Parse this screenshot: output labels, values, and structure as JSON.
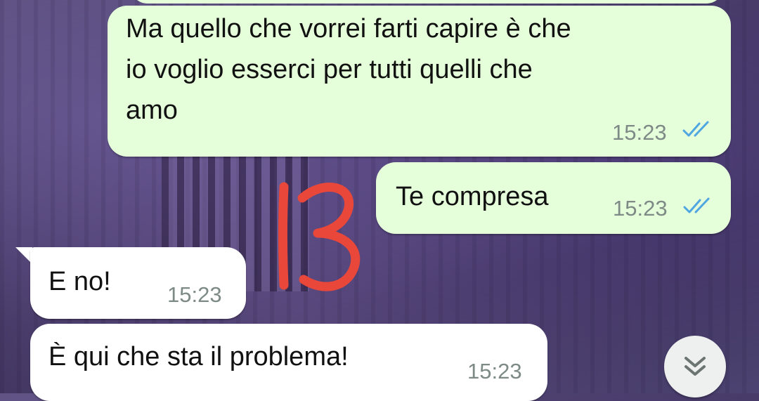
{
  "chat": {
    "messages": [
      {
        "direction": "outgoing",
        "text": "Ma quello che vorrei farti capire è che\nio voglio esserci per tutti quelli che\namo",
        "time": "15:23",
        "status": "read"
      },
      {
        "direction": "outgoing",
        "text": "Te compresa",
        "time": "15:23",
        "status": "read"
      },
      {
        "direction": "incoming",
        "text": "E no!",
        "time": "15:23"
      },
      {
        "direction": "incoming",
        "text": "È qui che sta il problema!",
        "time": "15:23"
      }
    ]
  },
  "annotation": {
    "text": "13",
    "color": "#e8473a"
  },
  "scroll_button": {
    "icon": "double-chevron-down-icon"
  },
  "colors": {
    "outgoing_bubble": "#e6ffdb",
    "incoming_bubble": "#ffffff",
    "read_ticks": "#4fa6e0",
    "timestamp": "#7d8a86"
  }
}
